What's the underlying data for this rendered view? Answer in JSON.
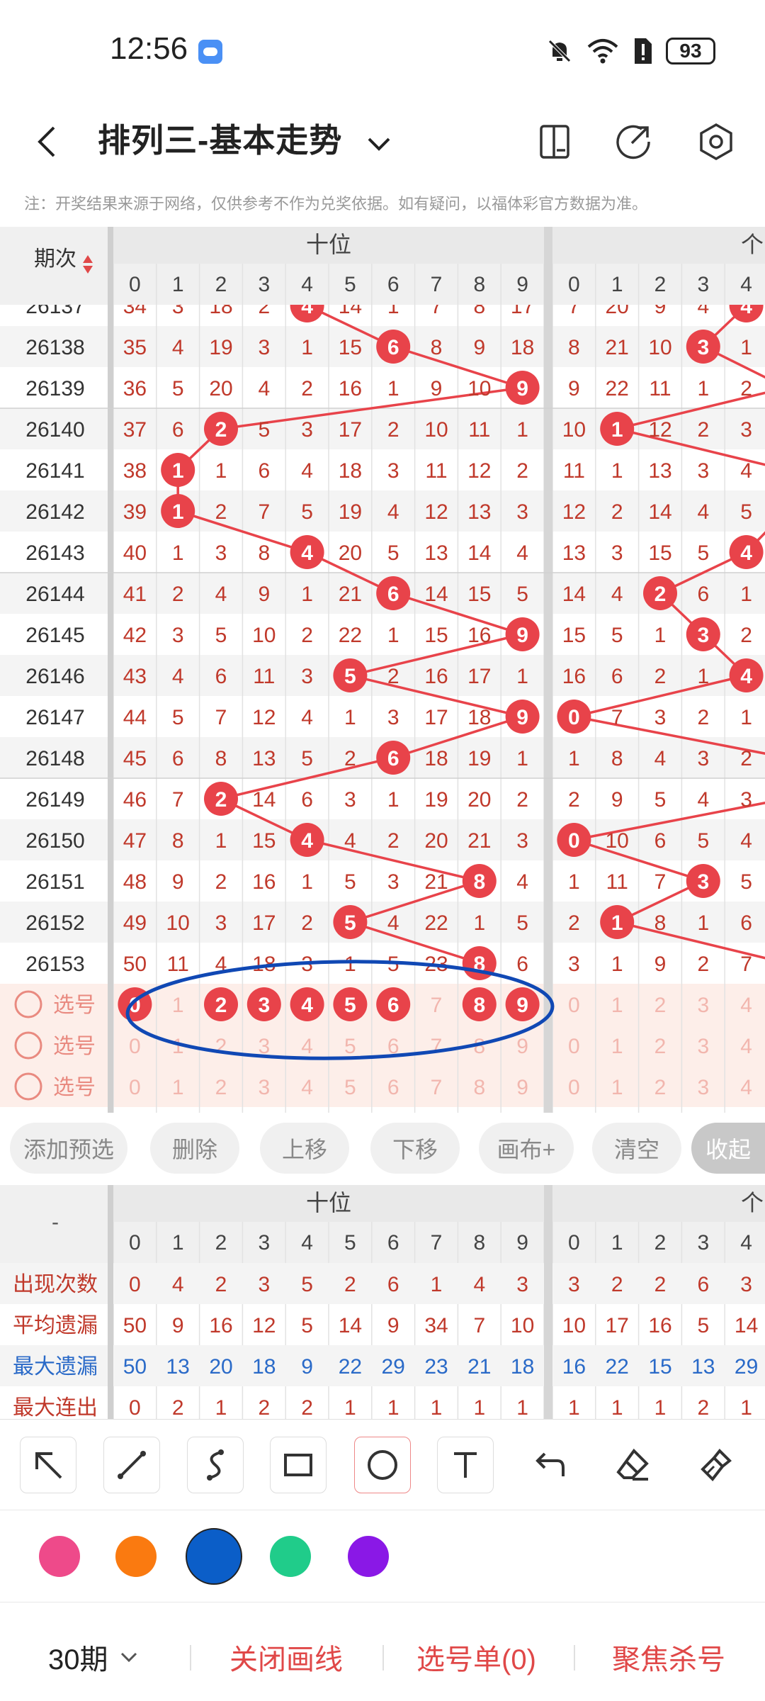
{
  "status": {
    "time": "12:56",
    "battery": "93"
  },
  "header": {
    "title": "排列三-基本走势"
  },
  "notice": "注：开奖结果来源于网络，仅供参考不作为兑奖依据。如有疑问，以福体彩官方数据为准。",
  "table": {
    "period_header": "期次",
    "group_tens": "十位",
    "group_units": "个",
    "digits": [
      "0",
      "1",
      "2",
      "3",
      "4",
      "5",
      "6",
      "7",
      "8",
      "9"
    ],
    "rows": [
      {
        "period": "26137",
        "t": [
          "34",
          "3",
          "18",
          "2",
          "4",
          "14",
          "1",
          "7",
          "8",
          "17"
        ],
        "u": [
          "7",
          "20",
          "9",
          "4",
          "4"
        ],
        "tw": 4,
        "uw": 4
      },
      {
        "period": "26138",
        "t": [
          "35",
          "4",
          "19",
          "3",
          "1",
          "15",
          "6",
          "8",
          "9",
          "18"
        ],
        "u": [
          "8",
          "21",
          "10",
          "3",
          "1"
        ],
        "tw": 6,
        "uw": 3
      },
      {
        "period": "26139",
        "t": [
          "36",
          "5",
          "20",
          "4",
          "2",
          "16",
          "1",
          "9",
          "10",
          "9"
        ],
        "u": [
          "9",
          "22",
          "11",
          "1",
          "2"
        ],
        "tw": 9,
        "uw": -1
      },
      {
        "period": "26140",
        "t": [
          "37",
          "6",
          "2",
          "5",
          "3",
          "17",
          "2",
          "10",
          "11",
          "1"
        ],
        "u": [
          "10",
          "1",
          "12",
          "2",
          "3"
        ],
        "tw": 2,
        "uw": 1
      },
      {
        "period": "26141",
        "t": [
          "38",
          "1",
          "1",
          "6",
          "4",
          "18",
          "3",
          "11",
          "12",
          "2"
        ],
        "u": [
          "11",
          "1",
          "13",
          "3",
          "4"
        ],
        "tw": 1,
        "uw": -1
      },
      {
        "period": "26142",
        "t": [
          "39",
          "1",
          "2",
          "7",
          "5",
          "19",
          "4",
          "12",
          "13",
          "3"
        ],
        "u": [
          "12",
          "2",
          "14",
          "4",
          "5"
        ],
        "tw": 1,
        "uw": -1
      },
      {
        "period": "26143",
        "t": [
          "40",
          "1",
          "3",
          "8",
          "4",
          "20",
          "5",
          "13",
          "14",
          "4"
        ],
        "u": [
          "13",
          "3",
          "15",
          "5",
          "4"
        ],
        "tw": 4,
        "uw": 4
      },
      {
        "period": "26144",
        "t": [
          "41",
          "2",
          "4",
          "9",
          "1",
          "21",
          "6",
          "14",
          "15",
          "5"
        ],
        "u": [
          "14",
          "4",
          "2",
          "6",
          "1"
        ],
        "tw": 6,
        "uw": 2
      },
      {
        "period": "26145",
        "t": [
          "42",
          "3",
          "5",
          "10",
          "2",
          "22",
          "1",
          "15",
          "16",
          "9"
        ],
        "u": [
          "15",
          "5",
          "1",
          "3",
          "2"
        ],
        "tw": 9,
        "uw": 3
      },
      {
        "period": "26146",
        "t": [
          "43",
          "4",
          "6",
          "11",
          "3",
          "5",
          "2",
          "16",
          "17",
          "1"
        ],
        "u": [
          "16",
          "6",
          "2",
          "1",
          "4"
        ],
        "tw": 5,
        "uw": 4
      },
      {
        "period": "26147",
        "t": [
          "44",
          "5",
          "7",
          "12",
          "4",
          "1",
          "3",
          "17",
          "18",
          "9"
        ],
        "u": [
          "0",
          "7",
          "3",
          "2",
          "1"
        ],
        "tw": 9,
        "uw": 0
      },
      {
        "period": "26148",
        "t": [
          "45",
          "6",
          "8",
          "13",
          "5",
          "2",
          "6",
          "18",
          "19",
          "1"
        ],
        "u": [
          "1",
          "8",
          "4",
          "3",
          "2"
        ],
        "tw": 6,
        "uw": -1
      },
      {
        "period": "26149",
        "t": [
          "46",
          "7",
          "2",
          "14",
          "6",
          "3",
          "1",
          "19",
          "20",
          "2"
        ],
        "u": [
          "2",
          "9",
          "5",
          "4",
          "3"
        ],
        "tw": 2,
        "uw": -1
      },
      {
        "period": "26150",
        "t": [
          "47",
          "8",
          "1",
          "15",
          "4",
          "4",
          "2",
          "20",
          "21",
          "3"
        ],
        "u": [
          "0",
          "10",
          "6",
          "5",
          "4"
        ],
        "tw": 4,
        "uw": 0
      },
      {
        "period": "26151",
        "t": [
          "48",
          "9",
          "2",
          "16",
          "1",
          "5",
          "3",
          "21",
          "8",
          "4"
        ],
        "u": [
          "1",
          "11",
          "7",
          "3",
          "5"
        ],
        "tw": 8,
        "uw": 3
      },
      {
        "period": "26152",
        "t": [
          "49",
          "10",
          "3",
          "17",
          "2",
          "5",
          "4",
          "22",
          "1",
          "5"
        ],
        "u": [
          "2",
          "1",
          "8",
          "1",
          "6"
        ],
        "tw": 5,
        "uw": 1
      },
      {
        "period": "26153",
        "t": [
          "50",
          "11",
          "4",
          "18",
          "3",
          "1",
          "5",
          "23",
          "8",
          "6"
        ],
        "u": [
          "3",
          "1",
          "9",
          "2",
          "7"
        ],
        "tw": 8,
        "uw": -1
      }
    ],
    "select_label": "选号",
    "selected_tens": [
      0,
      2,
      3,
      4,
      5,
      6,
      8,
      9
    ],
    "units_digits": [
      "0",
      "1",
      "2",
      "3",
      "4"
    ]
  },
  "actions": [
    "添加预选",
    "删除",
    "上移",
    "下移",
    "画布+",
    "清空",
    "收起"
  ],
  "stats": {
    "corner": "-",
    "group_tens": "十位",
    "group_units": "个",
    "rows": [
      {
        "label": "出现次数",
        "t": [
          "0",
          "4",
          "2",
          "3",
          "5",
          "2",
          "6",
          "1",
          "4",
          "3"
        ],
        "u": [
          "3",
          "2",
          "2",
          "6",
          "3"
        ],
        "color": "#c0392b"
      },
      {
        "label": "平均遗漏",
        "t": [
          "50",
          "9",
          "16",
          "12",
          "5",
          "14",
          "9",
          "34",
          "7",
          "10"
        ],
        "u": [
          "10",
          "17",
          "16",
          "5",
          "14"
        ],
        "color": "#c0392b"
      },
      {
        "label": "最大遗漏",
        "t": [
          "50",
          "13",
          "20",
          "18",
          "9",
          "22",
          "29",
          "23",
          "21",
          "18"
        ],
        "u": [
          "16",
          "22",
          "15",
          "13",
          "29"
        ],
        "color": "#2a6ac8"
      },
      {
        "label": "最大连出",
        "t": [
          "0",
          "2",
          "1",
          "2",
          "2",
          "1",
          "1",
          "1",
          "1",
          "1"
        ],
        "u": [
          "1",
          "1",
          "1",
          "2",
          "1"
        ],
        "color": "#c0392b"
      }
    ]
  },
  "draw_tools": [
    "arrow-icon",
    "line-icon",
    "curve-icon",
    "rectangle-icon",
    "circle-icon",
    "text-icon",
    "undo-icon",
    "eraser-icon",
    "clear-brush-icon"
  ],
  "palette": [
    "#ee4a8a",
    "#fa7a10",
    "#0b5ec8",
    "#20cc8a",
    "#8a18e6"
  ],
  "bottom": {
    "periods": "30期",
    "close_lines": "关闭画线",
    "selection_list": "选号单(0)",
    "focus_kill": "聚焦杀号"
  }
}
